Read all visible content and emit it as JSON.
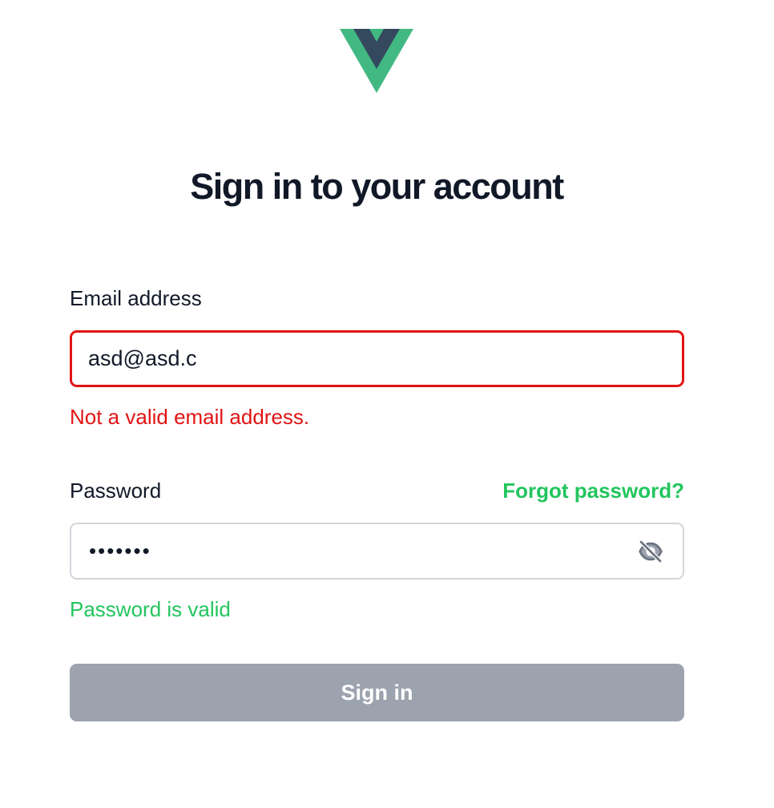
{
  "brand": {
    "logo_icon": "vue-logo-icon",
    "colors": {
      "outer": "#42b883",
      "inner": "#35495e"
    }
  },
  "page": {
    "title": "Sign in to your account"
  },
  "email": {
    "label": "Email address",
    "value": "asd@asd.c",
    "error": "Not a valid email address.",
    "border_color": "#e01414"
  },
  "password": {
    "label": "Password",
    "forgot_label": "Forgot password?",
    "value": "•••••••",
    "status": "Password is valid",
    "toggle_icon": "eye-off-icon",
    "status_color": "#22c55e"
  },
  "submit": {
    "label": "Sign in",
    "disabled_color": "#9ca3af"
  }
}
